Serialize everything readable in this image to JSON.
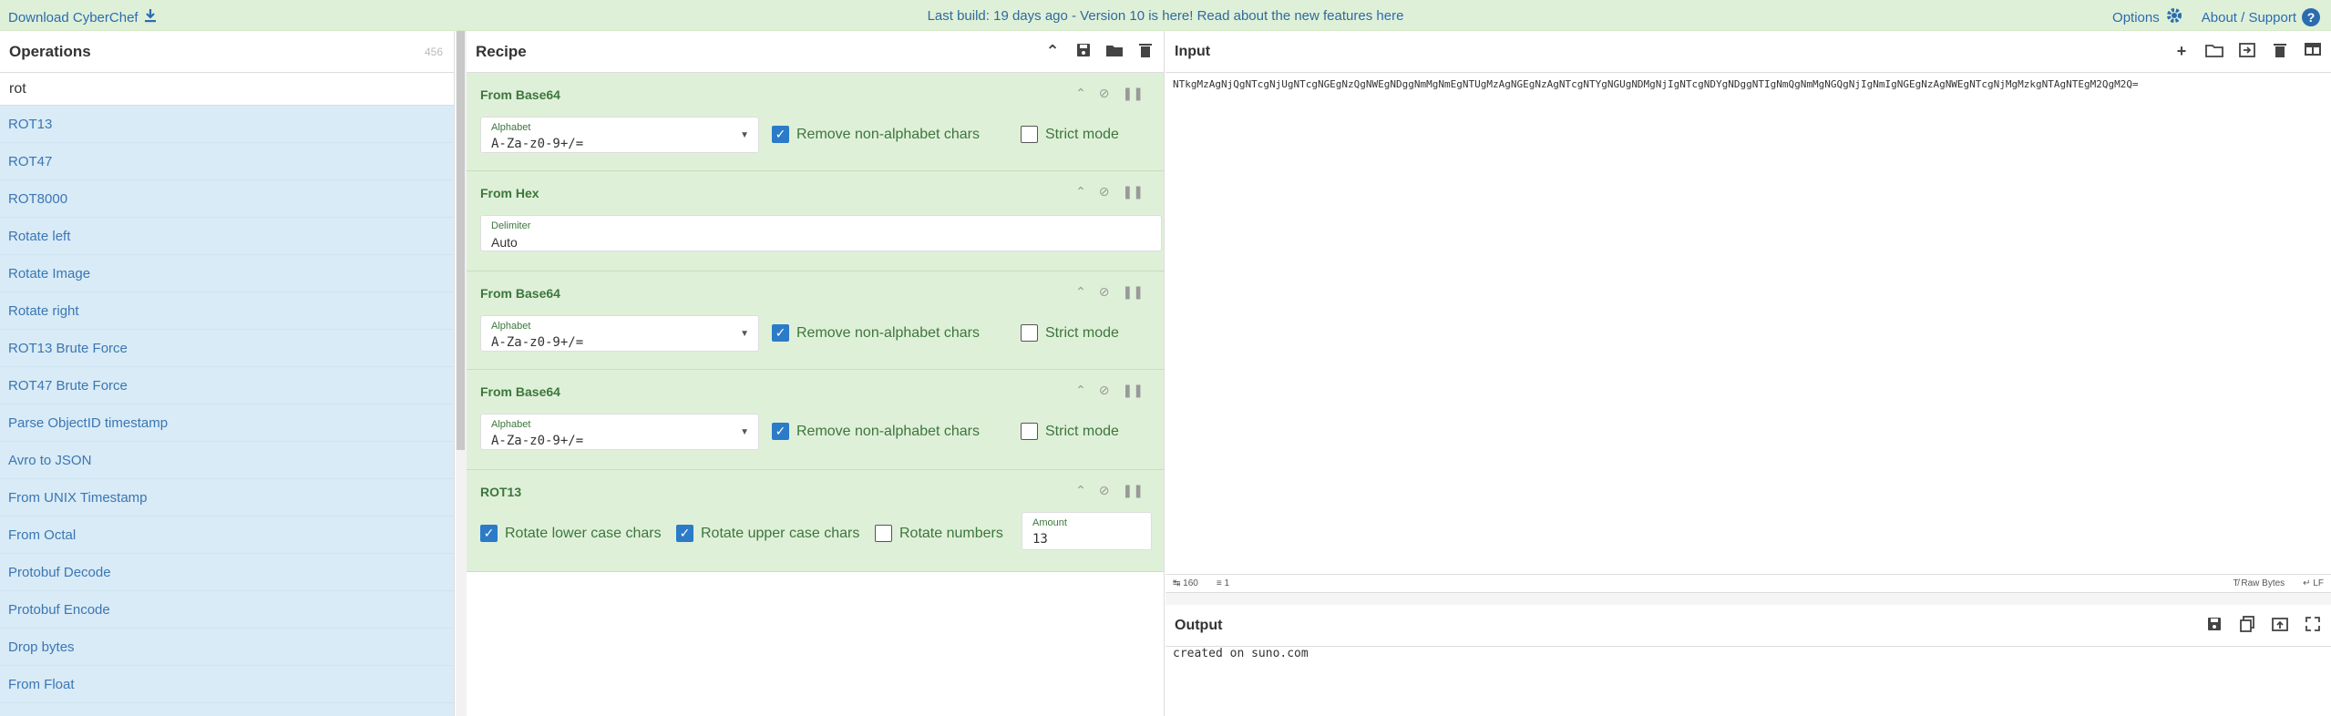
{
  "banner": {
    "download_label": "Download CyberChef",
    "notice_text": "Last build: 19 days ago - Version 10 is here! Read about the new features ",
    "notice_link": "here",
    "options_label": "Options",
    "about_label": "About / Support"
  },
  "operations": {
    "title": "Operations",
    "count": "456",
    "search_value": "rot",
    "items": [
      "ROT13",
      "ROT47",
      "ROT8000",
      "Rotate left",
      "Rotate Image",
      "Rotate right",
      "ROT13 Brute Force",
      "ROT47 Brute Force",
      "Parse ObjectID timestamp",
      "Avro to JSON",
      "From UNIX Timestamp",
      "From Octal",
      "Protobuf Decode",
      "Protobuf Encode",
      "Drop bytes",
      "From Float"
    ]
  },
  "recipe": {
    "title": "Recipe",
    "ops": [
      {
        "name": "From Base64",
        "alphabet_label": "Alphabet",
        "alphabet_value": "A-Za-z0-9+/=",
        "remove_label": "Remove non-alphabet chars",
        "strict_label": "Strict mode"
      },
      {
        "name": "From Hex",
        "delimiter_label": "Delimiter",
        "delimiter_value": "Auto"
      },
      {
        "name": "From Base64",
        "alphabet_label": "Alphabet",
        "alphabet_value": "A-Za-z0-9+/=",
        "remove_label": "Remove non-alphabet chars",
        "strict_label": "Strict mode"
      },
      {
        "name": "From Base64",
        "alphabet_label": "Alphabet",
        "alphabet_value": "A-Za-z0-9+/=",
        "remove_label": "Remove non-alphabet chars",
        "strict_label": "Strict mode"
      },
      {
        "name": "ROT13",
        "lower_label": "Rotate lower case chars",
        "upper_label": "Rotate upper case chars",
        "numbers_label": "Rotate numbers",
        "amount_label": "Amount",
        "amount_value": "13"
      }
    ]
  },
  "input": {
    "title": "Input",
    "text": "NTkgMzAgNjQgNTcgNjUgNTcgNGEgNzQgNWEgNDggNmMgNmEgNTUgMzAgNGEgNzAgNTcgNTYgNGUgNDMgNjIgNTcgNDYgNDggNTIgNmQgNmMgNGQgNjIgNmIgNGEgNzAgNWEgNTcgNjMgMzkgNTAgNTEgM2QgM2Q=",
    "length": "160",
    "lines": "1",
    "encoding": "Raw Bytes",
    "eol": "LF"
  },
  "output": {
    "title": "Output",
    "text": "created on suno.com"
  }
}
